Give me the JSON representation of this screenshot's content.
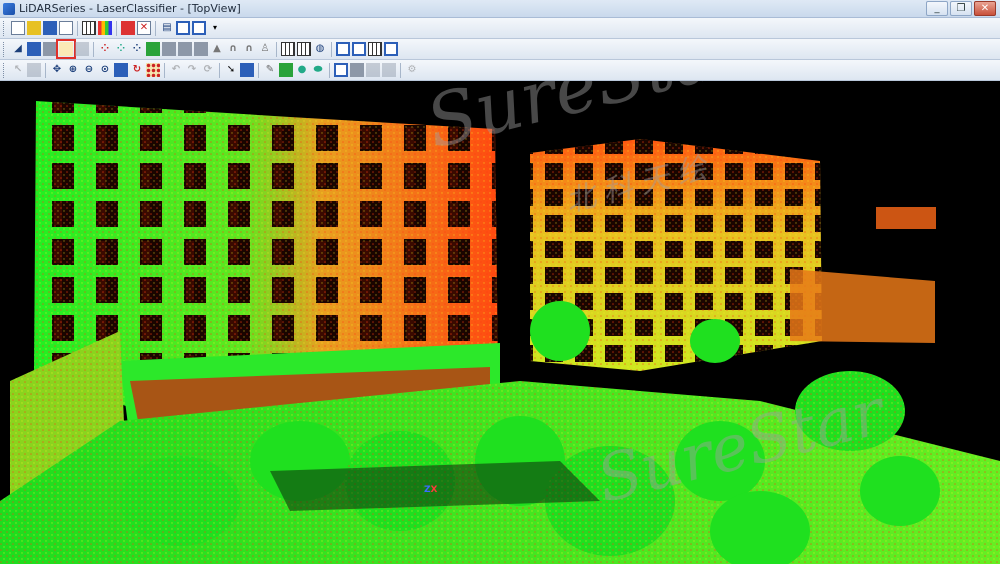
{
  "window": {
    "title": "LiDARSeries - LaserClassifier - [TopView]",
    "controls": {
      "minimize": "_",
      "restore": "❐",
      "close": "✕"
    }
  },
  "toolbar_row1": {
    "buttons": [
      {
        "name": "new-project",
        "icon": "doc"
      },
      {
        "name": "open-project",
        "icon": "folder"
      },
      {
        "name": "save",
        "icon": "disk"
      },
      {
        "name": "import",
        "icon": "doc-blue"
      },
      {
        "name": "color-bars",
        "icon": "bars"
      },
      {
        "name": "color-palette",
        "icon": "palette"
      },
      {
        "name": "delete-class",
        "icon": "delete"
      },
      {
        "name": "delete-all",
        "icon": "delete-all"
      },
      {
        "name": "layers",
        "icon": "layers"
      },
      {
        "name": "panel-split",
        "icon": "split"
      },
      {
        "name": "panel-columns",
        "icon": "columns"
      }
    ]
  },
  "toolbar_row2": {
    "highlighted_tool": "point-cloud-display"
  },
  "toolbar_row3": {},
  "viewport": {
    "view_name": "TopView",
    "watermark_main": "SureStar",
    "watermark_sub": "北科天绘",
    "watermark_bottom": "SureStar",
    "axis_z": "Z",
    "axis_x": "X",
    "colors": {
      "background": "#000000",
      "low": "#22ee22",
      "mid": "#e8e820",
      "high": "#ff4a10"
    }
  }
}
